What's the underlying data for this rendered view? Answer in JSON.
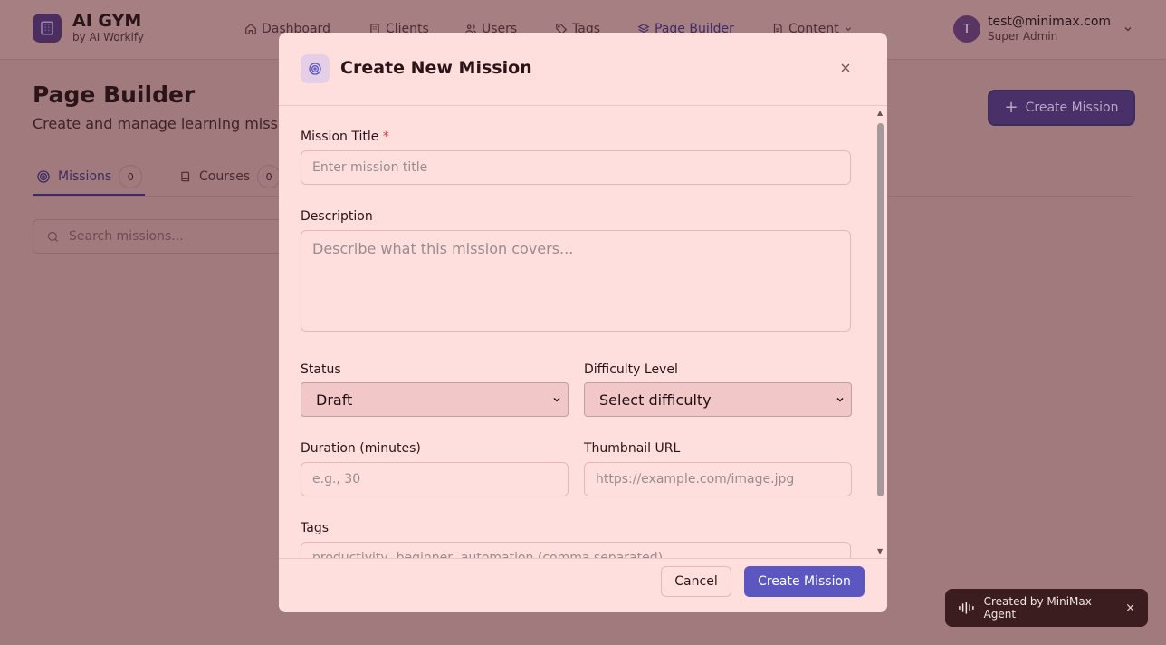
{
  "brand": {
    "title": "AI GYM",
    "subtitle": "by AI Workify"
  },
  "nav": [
    {
      "label": "Dashboard",
      "icon": "home-icon"
    },
    {
      "label": "Clients",
      "icon": "building-icon"
    },
    {
      "label": "Users",
      "icon": "users-icon"
    },
    {
      "label": "Tags",
      "icon": "tag-icon"
    },
    {
      "label": "Page Builder",
      "icon": "layers-icon",
      "active": true
    },
    {
      "label": "Content",
      "icon": "document-icon",
      "has_dropdown": true
    }
  ],
  "user": {
    "initial": "T",
    "email": "test@minimax.com",
    "role": "Super Admin"
  },
  "page": {
    "title": "Page Builder",
    "subtitle": "Create and manage learning missions",
    "create_button": "Create Mission",
    "tabs": [
      {
        "label": "Missions",
        "count": "0",
        "icon": "target-icon",
        "active": true
      },
      {
        "label": "Courses",
        "count": "0",
        "icon": "book-icon"
      }
    ],
    "search_placeholder": "Search missions..."
  },
  "modal": {
    "title": "Create New Mission",
    "fields": {
      "title": {
        "label": "Mission Title",
        "required": "*",
        "placeholder": "Enter mission title"
      },
      "description": {
        "label": "Description",
        "placeholder": "Describe what this mission covers..."
      },
      "status": {
        "label": "Status",
        "value": "Draft"
      },
      "difficulty": {
        "label": "Difficulty Level",
        "value": "Select difficulty"
      },
      "duration": {
        "label": "Duration (minutes)",
        "placeholder": "e.g., 30"
      },
      "thumbnail": {
        "label": "Thumbnail URL",
        "placeholder": "https://example.com/image.jpg"
      },
      "tags": {
        "label": "Tags",
        "placeholder": "productivity, beginner, automation (comma separated)"
      }
    },
    "cancel_label": "Cancel",
    "submit_label": "Create Mission"
  },
  "badge": {
    "text": "Created by MiniMax Agent",
    "close": "×"
  },
  "colors": {
    "accent": "#5b56c0",
    "overlay": "#a07a7c",
    "modal_bg": "#ffdede",
    "required": "#d33c3c"
  }
}
